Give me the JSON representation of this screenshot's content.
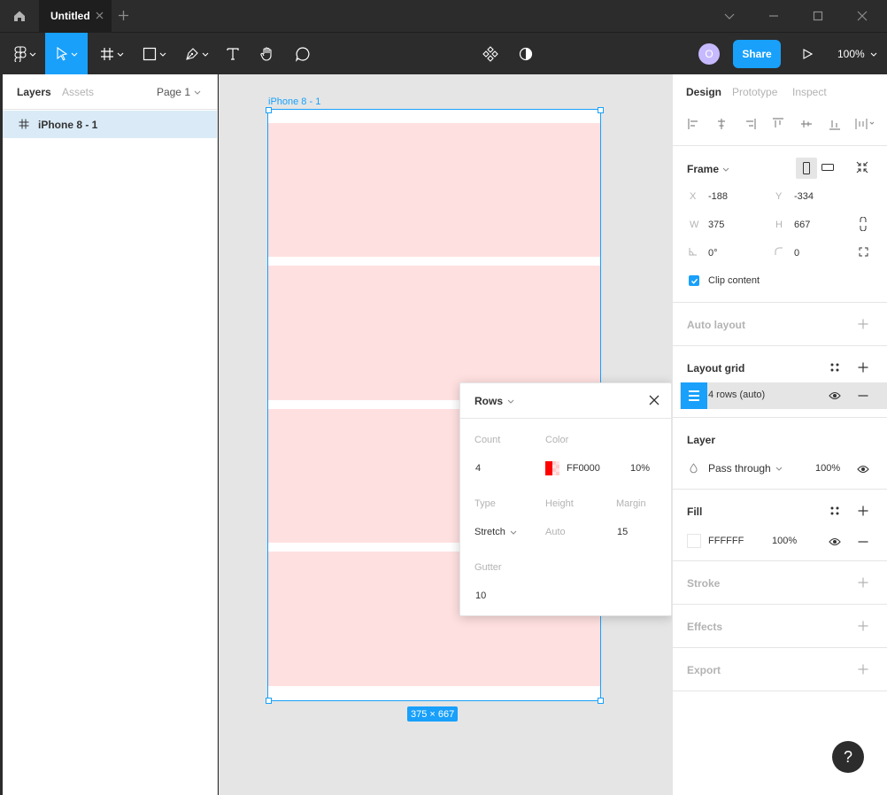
{
  "titlebar": {
    "tab_label": "Untitled"
  },
  "toolbar": {
    "avatar_initial": "O",
    "share_label": "Share",
    "zoom_label": "100%"
  },
  "left_panel": {
    "tabs": [
      "Layers",
      "Assets"
    ],
    "page_selector": "Page 1",
    "layers": [
      {
        "name": "iPhone 8 - 1"
      }
    ]
  },
  "canvas": {
    "frame_label": "iPhone 8 - 1",
    "size_badge": "375 × 667",
    "grid_color": "#ffe0e0",
    "selection_color": "#18a0fb"
  },
  "grid_popup": {
    "title": "Rows",
    "count_label": "Count",
    "count_value": "4",
    "color_label": "Color",
    "color_hex": "FF0000",
    "color_opacity": "10%",
    "type_label": "Type",
    "type_value": "Stretch",
    "height_label": "Height",
    "height_value": "Auto",
    "margin_label": "Margin",
    "margin_value": "15",
    "gutter_label": "Gutter",
    "gutter_value": "10"
  },
  "right_panel": {
    "tabs": [
      "Design",
      "Prototype",
      "Inspect"
    ],
    "frame": {
      "title": "Frame",
      "x_label": "X",
      "x_value": "-188",
      "y_label": "Y",
      "y_value": "-334",
      "w_label": "W",
      "w_value": "375",
      "h_label": "H",
      "h_value": "667",
      "rotation_value": "0°",
      "radius_value": "0",
      "clip_label": "Clip content"
    },
    "auto_layout": {
      "title": "Auto layout"
    },
    "layout_grid": {
      "title": "Layout grid",
      "item_label": "4 rows (auto)"
    },
    "layer": {
      "title": "Layer",
      "blend_mode": "Pass through",
      "opacity": "100%"
    },
    "fill": {
      "title": "Fill",
      "hex": "FFFFFF",
      "opacity": "100%"
    },
    "stroke": {
      "title": "Stroke"
    },
    "effects": {
      "title": "Effects"
    },
    "export": {
      "title": "Export"
    },
    "help_label": "?"
  },
  "colors": {
    "accent": "#18a0fb",
    "chrome_dark": "#2c2c2c",
    "canvas_bg": "#e5e5e5",
    "grid_red": "#ff0000"
  }
}
